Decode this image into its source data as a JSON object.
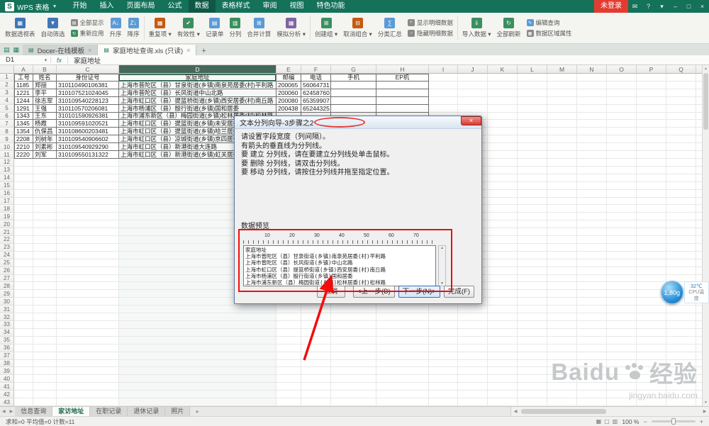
{
  "titlebar": {
    "logo": "S",
    "app_name": "WPS 表格",
    "menu_tabs": [
      "开始",
      "插入",
      "页面布局",
      "公式",
      "数据",
      "表格样式",
      "审阅",
      "视图",
      "特色功能"
    ],
    "active_tab": "数据",
    "login_button": "未登录",
    "window_icons": [
      {
        "name": "message-icon",
        "glyph": "✉"
      },
      {
        "name": "help-icon",
        "glyph": "?"
      },
      {
        "name": "skin-caret-icon",
        "glyph": "▾"
      },
      {
        "name": "minimize-icon",
        "glyph": "–"
      },
      {
        "name": "maximize-icon",
        "glyph": "□"
      },
      {
        "name": "close-icon",
        "glyph": "×"
      }
    ]
  },
  "ribbon": {
    "items": [
      {
        "label": "数据透视表",
        "kind": "big",
        "icon": "pivot-table",
        "glyph": "▦",
        "color": "#3f76b5"
      },
      {
        "label": "自动筛选",
        "kind": "big",
        "icon": "filter",
        "glyph": "▼",
        "color": "#3f76b5"
      },
      {
        "label": "全部显示",
        "kind": "small",
        "icon": "show-all",
        "glyph": "▤",
        "color": "#8a8a88"
      },
      {
        "label": "重新应用",
        "kind": "small",
        "icon": "reapply",
        "glyph": "↻",
        "color": "#3a8f5f"
      },
      {
        "label": "升序",
        "kind": "big",
        "icon": "sort-ascending",
        "glyph": "A↓",
        "color": "#5b9bd5"
      },
      {
        "label": "降序",
        "kind": "big",
        "icon": "sort-descending",
        "glyph": "Z↓",
        "color": "#5b9bd5"
      },
      {
        "sep": true
      },
      {
        "label": "重复项",
        "kind": "big",
        "dropdown": true,
        "icon": "duplicates",
        "glyph": "▦",
        "color": "#c55a11"
      },
      {
        "label": "有效性",
        "kind": "big",
        "dropdown": true,
        "icon": "validation",
        "glyph": "✔",
        "color": "#3a8f5f"
      },
      {
        "label": "记录单",
        "kind": "big",
        "icon": "record-form",
        "glyph": "▤",
        "color": "#5b9bd5"
      },
      {
        "label": "分列",
        "kind": "big",
        "icon": "text-to-columns",
        "glyph": "▥",
        "color": "#3a8f5f"
      },
      {
        "label": "合并计算",
        "kind": "big",
        "icon": "consolidate",
        "glyph": "⊞",
        "color": "#5b9bd5"
      },
      {
        "label": "模拟分析",
        "kind": "big",
        "dropdown": true,
        "icon": "what-if",
        "glyph": "▦",
        "color": "#8064a2"
      },
      {
        "sep": true
      },
      {
        "label": "创建组",
        "kind": "big",
        "dropdown": true,
        "icon": "group",
        "glyph": "⊞",
        "color": "#3a8f5f"
      },
      {
        "label": "取消组合",
        "kind": "big",
        "dropdown": true,
        "icon": "ungroup",
        "glyph": "⊟",
        "color": "#c55a11"
      },
      {
        "label": "分类汇总",
        "kind": "big",
        "icon": "subtotal",
        "glyph": "∑",
        "color": "#5b9bd5"
      },
      {
        "label": "显示明细数据",
        "kind": "small",
        "icon": "show-detail",
        "glyph": "+",
        "color": "#8a8a88"
      },
      {
        "label": "隐藏明细数据",
        "kind": "small",
        "icon": "hide-detail",
        "glyph": "−",
        "color": "#8a8a88"
      },
      {
        "sep": true
      },
      {
        "label": "导入数据",
        "kind": "big",
        "dropdown": true,
        "icon": "import-data",
        "glyph": "⇓",
        "color": "#3a8f5f"
      },
      {
        "label": "全部刷新",
        "kind": "big",
        "icon": "refresh-all",
        "glyph": "↻",
        "color": "#3a8f5f"
      },
      {
        "label": "编辑查询",
        "kind": "small",
        "icon": "edit-query",
        "glyph": "✎",
        "color": "#5b9bd5"
      },
      {
        "label": "数据区域属性",
        "kind": "small",
        "icon": "data-range-properties",
        "glyph": "▦",
        "color": "#8a8a88"
      }
    ]
  },
  "doc_tabs": {
    "quick_icons": [
      {
        "name": "new-file-icon",
        "glyph": "▤"
      },
      {
        "name": "templates-icon",
        "glyph": "▦"
      }
    ],
    "tabs": [
      {
        "label": "Docer-在线模板",
        "close": "×",
        "active": false
      },
      {
        "label": "家庭地址查询.xls (只读)",
        "close": "×",
        "active": true
      }
    ],
    "add": "+"
  },
  "formula_bar": {
    "name_box": "D1",
    "caret": "▾",
    "fx": "fx",
    "value": "家庭地址"
  },
  "grid": {
    "columns": [
      "A",
      "B",
      "C",
      "D",
      "E",
      "F",
      "G",
      "H",
      "I",
      "J",
      "K",
      "L",
      "M",
      "N",
      "O",
      "P",
      "Q",
      "R"
    ],
    "selected_column": "D",
    "selected_cell": "D1",
    "row_count": 43,
    "header_row": [
      "工号",
      "姓名",
      "身份证号",
      "家庭地址",
      "邮编",
      "电话",
      "手机",
      "EP机"
    ],
    "rows": [
      [
        "1185",
        "郑丽",
        "310110490106381",
        "上海市普陀区（县）甘泉街道(乡镇)南泉苑居委(村)平利路",
        "200065",
        "56064731",
        "",
        ""
      ],
      [
        "1221",
        "李平",
        "310107521024045",
        "上海市普陀区（县）长风街道中山北路",
        "200060",
        "62458760",
        "",
        ""
      ],
      [
        "1244",
        "徐志翠",
        "310109540228123",
        "上海市虹口区（县）提篮桥街道(乡镇)西安居委(村)南丘路",
        "200080",
        "65359907",
        "",
        ""
      ],
      [
        "1291",
        "王强",
        "310110570206081",
        "上海市杨浦区（县）殷行街道(乡镇)国和居委",
        "200438",
        "65244325",
        "",
        ""
      ],
      [
        "1343",
        "王东",
        "310101590926381",
        "上海市浦东新区（县）梅园街道(乡镇)松林居委(村)松林路",
        "",
        "",
        "",
        ""
      ],
      [
        "1345",
        "杨霞",
        "310109591020521",
        "上海市虹口区（县）提篮街道(乡镇)未安居委",
        "",
        "",
        "",
        ""
      ],
      [
        "1354",
        "仇保昌",
        "310108600203481",
        "上海市虹口区（县）提篮街道(乡镇)哈兰居委",
        "",
        "",
        "",
        ""
      ],
      [
        "2208",
        "刘树年",
        "310109540906602",
        "上海市虹口区（县）凉城街道(乡镇)京四居委",
        "",
        "",
        "",
        ""
      ],
      [
        "2210",
        "刘素彬",
        "310109540929290",
        "上海市虹口区（县）新港街道大连路",
        "",
        "",
        "",
        ""
      ],
      [
        "2220",
        "刘军",
        "310109550131322",
        "上海市虹口区（县）新港街道(乡镇)虹关居委",
        "",
        "",
        "",
        ""
      ]
    ]
  },
  "dialog": {
    "title": "文本分列向导-3步骤之2",
    "close": "×",
    "instructions": [
      "请设置字段宽度（列间隔）。",
      "有箭头的垂直线为分列线。",
      "要 建立 分列线，请在要建立分列线处单击鼠标。",
      "要 删除 分列线，请双击分列线。",
      "要 移动 分列线，请按住分列线并拖至指定位置。"
    ],
    "preview_label": "数据预览",
    "ruler_ticks": [
      "10",
      "20",
      "30",
      "40",
      "50",
      "60",
      "70"
    ],
    "preview_lines": [
      "家庭地址",
      "上海市普陀区（县）甘泉街道(乡镇)南泉苑居委(村)平利路",
      "上海市普陀区（县）长风街道(乡镇)中山北路",
      "上海市虹口区（县）提篮桥街道(乡镇)西安居委(村)南丘路",
      "上海市杨浦区（县）殷行街道(乡镇)国和居委",
      "上海市浦东新区（县）梅园街道(乡镇)松林居委(村)松林路"
    ],
    "buttons": {
      "cancel": "取消",
      "back": "<上一步(B)",
      "next": "下一步(N)>",
      "finish": "完成(F)"
    }
  },
  "sheet_tabs": {
    "nav_icons": [
      {
        "name": "tabs-scroll-left-icon",
        "glyph": "◀"
      },
      {
        "name": "tabs-scroll-right-icon",
        "glyph": "▶"
      }
    ],
    "tabs": [
      "信息查询",
      "家访地址",
      "在职记录",
      "退休记录",
      "照片"
    ],
    "active": "家访地址",
    "add": "+"
  },
  "status_bar": {
    "summary": "求和=0  平均值=0  计数=11",
    "view_icons": [
      {
        "name": "normal-view-icon",
        "glyph": "▦"
      },
      {
        "name": "page-layout-view-icon",
        "glyph": "▢"
      },
      {
        "name": "page-break-view-icon",
        "glyph": "▥"
      }
    ],
    "zoom_level": "100 %",
    "zoom_out": "−",
    "zoom_in": "+"
  },
  "float_widget": {
    "value": "1,80g",
    "temp": "32℃",
    "label": "CPU温度"
  },
  "watermark": {
    "brand": "Baidu",
    "suffix": "经验",
    "url": "jingyan.baidu.com"
  },
  "colors": {
    "titlebar": "#14715a",
    "login_red": "#e23c30",
    "annotation_red": "#f40b0b",
    "selected_header": "#44685a"
  }
}
